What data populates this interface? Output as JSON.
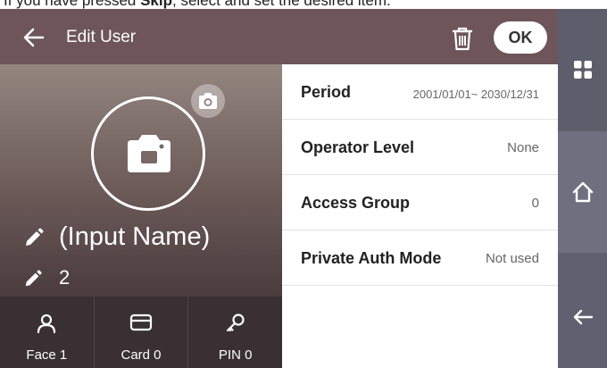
{
  "caption": {
    "before": "If you have pressed ",
    "bold": "Skip",
    "after": ", select and set the desired item."
  },
  "header": {
    "title": "Edit User",
    "ok_label": "OK",
    "back_icon": "arrow-left-icon",
    "delete_icon": "trash-icon"
  },
  "profile": {
    "name": "(Input Name)",
    "user_id": "2",
    "photo_icon": "camera-icon",
    "edit_icon": "pencil-icon"
  },
  "credentials": [
    {
      "label": "Face 1",
      "icon": "face-user-icon"
    },
    {
      "label": "Card 0",
      "icon": "card-icon"
    },
    {
      "label": "PIN 0",
      "icon": "key-icon"
    }
  ],
  "settings": [
    {
      "label": "Period",
      "value": "2001/01/01~ 2030/12/31"
    },
    {
      "label": "Operator Level",
      "value": "None"
    },
    {
      "label": "Access Group",
      "value": "0"
    },
    {
      "label": "Private Auth Mode",
      "value": "Not used"
    }
  ],
  "sidebar": {
    "menu_icon": "grid-menu-icon",
    "home_icon": "home-icon",
    "back_icon": "back-arrow-icon"
  },
  "colors": {
    "header_bg": "#6d5559",
    "credential_bar_bg": "#383032",
    "sidebar_bg": "#5c5e6b"
  }
}
